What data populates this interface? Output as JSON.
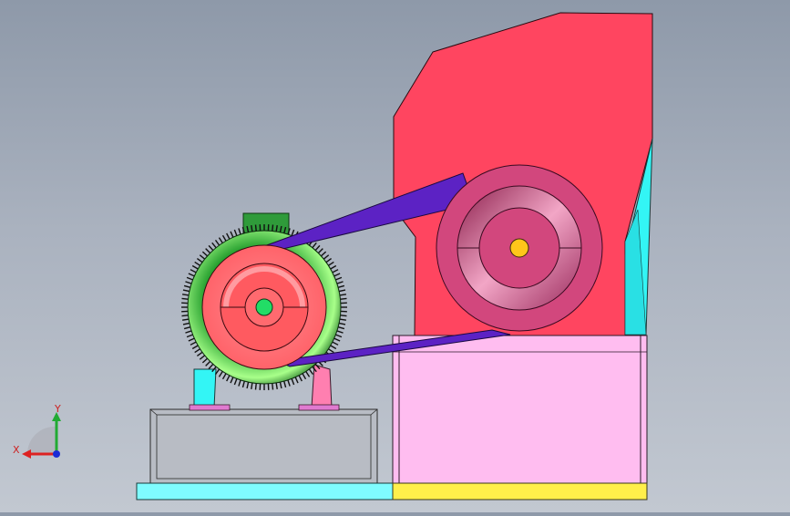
{
  "viewport": {
    "background_top": "#8e99a9",
    "background_bottom": "#c2c8d1"
  },
  "colors": {
    "hopper": "#ff4560",
    "housing": "#ffbdf0",
    "base_plate_left": "#7ffcff",
    "base_plate_right": "#ffef4a",
    "cyan_panel": "#33f5f5",
    "belt": "#5c22c4",
    "motor_body": "#1f9a2a",
    "motor_pulley": "#ff5f66",
    "motor_shaft": "#22dd66",
    "crusher_pulley": "#d2477d",
    "crusher_shaft": "#ffc61a",
    "motor_feet": "#ff7fb0",
    "motor_mount": "#b8bcc4",
    "terminal_box": "#2f9b3a"
  },
  "triad": {
    "x_label": "X",
    "y_label": "Y"
  }
}
